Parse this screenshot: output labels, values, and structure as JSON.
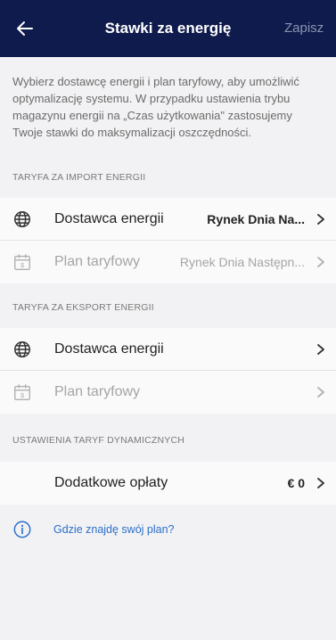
{
  "header": {
    "title": "Stawki za energię",
    "save_label": "Zapisz",
    "back_icon": "arrow-left-icon"
  },
  "intro": "Wybierz dostawcę energii i plan taryfowy, aby umożliwić optymalizację systemu. W przypadku ustawienia trybu magazynu energii na „Czas użytkowania\" zastosujemy Twoje stawki do maksymalizacji oszczędności.",
  "import": {
    "section_label": "TARYFA ZA IMPORT ENERGII",
    "provider": {
      "label": "Dostawca energii",
      "value": "Rynek Dnia Na...",
      "icon": "globe-icon"
    },
    "plan": {
      "label": "Plan taryfowy",
      "value": "Rynek Dnia Następn...",
      "icon": "calendar-dollar-icon"
    }
  },
  "export": {
    "section_label": "TARYFA ZA EKSPORT ENERGII",
    "provider": {
      "label": "Dostawca energii",
      "value": "",
      "icon": "globe-icon"
    },
    "plan": {
      "label": "Plan taryfowy",
      "value": "",
      "icon": "calendar-dollar-icon"
    }
  },
  "dynamic": {
    "section_label": "USTAWIENIA TARYF DYNAMICZNYCH",
    "fees": {
      "label": "Dodatkowe opłaty",
      "value": "€ 0"
    }
  },
  "help": {
    "text": "Gdzie znajdę swój plan?",
    "icon": "info-circle-icon"
  },
  "colors": {
    "header_bg": "#0f1b4c",
    "link": "#2b6fc9",
    "background": "#f2f2f4"
  }
}
